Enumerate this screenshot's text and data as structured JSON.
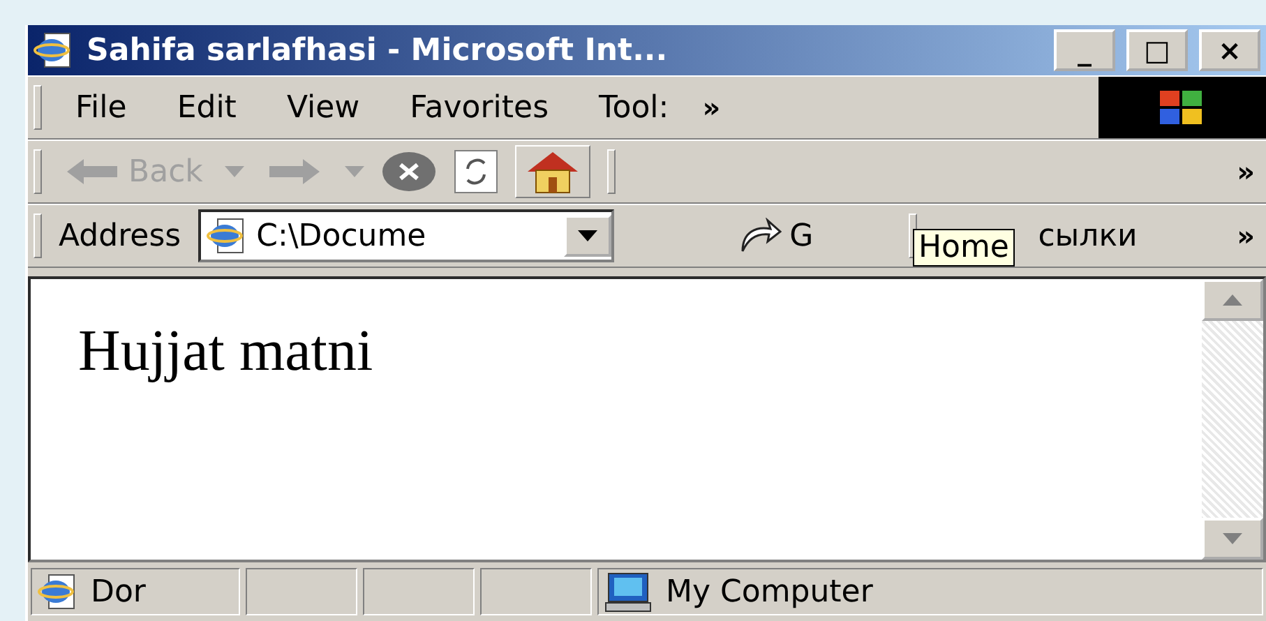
{
  "window": {
    "title": "Sahifa sarlafhasi - Microsoft Int...",
    "controls": [
      "_",
      "□",
      "×"
    ]
  },
  "menu": [
    {
      "label": "File"
    },
    {
      "label": "Edit"
    },
    {
      "label": "View"
    },
    {
      "label": "Favorites"
    },
    {
      "label": "Tool:"
    }
  ],
  "menu_more": "»",
  "toolbar": {
    "back": {
      "label": "Back",
      "disabled": true
    },
    "forward_disabled": true,
    "more": "»"
  },
  "address_bar": {
    "label": "Address",
    "value": "C:\\Docume",
    "go": "G",
    "links": "сылки",
    "more": "»"
  },
  "tooltip": "Home",
  "content": {
    "text": "Hujjat matni"
  },
  "status_bar": {
    "text": "Dor",
    "zone": "My Computer"
  }
}
